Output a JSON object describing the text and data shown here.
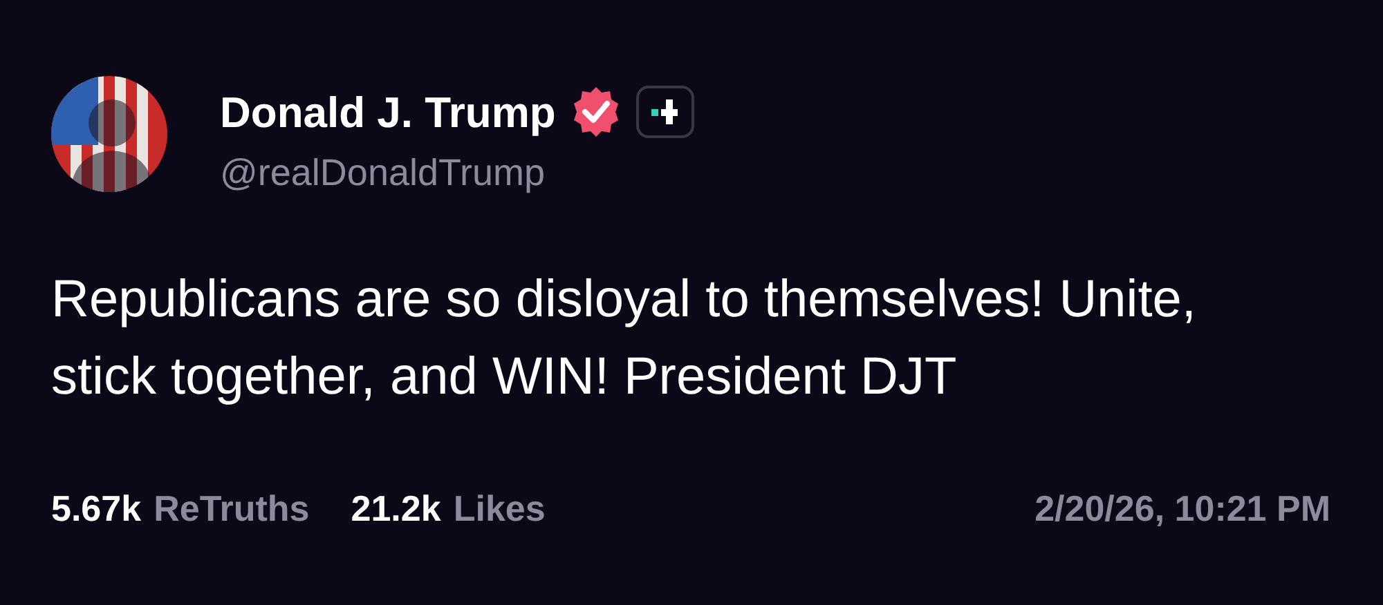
{
  "post": {
    "author": {
      "name": "Donald J. Trump",
      "handle": "@realDonaldTrump",
      "verified": true
    },
    "text": "Republicans are so disloyal to themselves! Unite, stick together, and WIN! President DJT",
    "stats": [
      {
        "count": "5.67k",
        "label": "ReTruths"
      },
      {
        "count": "21.2k",
        "label": "Likes"
      }
    ],
    "timestamp": "2/20/26, 10:21 PM"
  }
}
